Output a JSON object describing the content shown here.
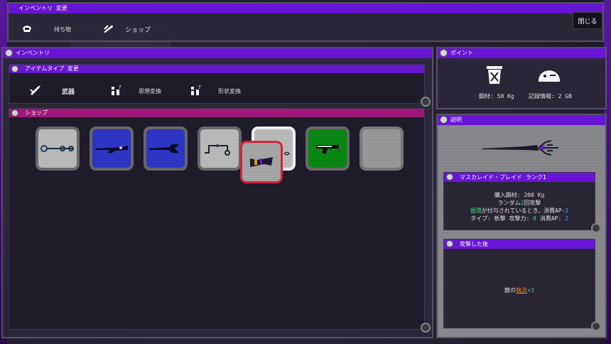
{
  "top_panel": {
    "title": "インベントリ 変更",
    "tabs": [
      {
        "label": "持ち物",
        "icon": "bag-icon"
      },
      {
        "label": "ショップ",
        "icon": "shop-icon"
      }
    ],
    "close_label": "閉じる"
  },
  "inventory": {
    "title": "インベントリ",
    "type_bar_title": "アイテムタイプ 変更",
    "types": [
      {
        "label": "武器",
        "icon": "weapon-icon"
      },
      {
        "label": "思想変換",
        "icon": "thought-icon"
      },
      {
        "label": "形状変換",
        "icon": "shape-icon"
      }
    ],
    "shop_title": "ショップ",
    "slots": [
      {
        "bg": "#bcbcbc",
        "icon": "chain-weapon-icon"
      },
      {
        "bg": "#2e36c8",
        "icon": "rifle-weapon-icon"
      },
      {
        "bg": "#2e36c8",
        "icon": "scissors-weapon-icon"
      },
      {
        "bg": "#bcbcbc",
        "icon": "hook-chain-weapon-icon"
      },
      {
        "bg": "#bcbcbc",
        "icon": "blade-weapon-icon",
        "selected": true
      },
      {
        "bg": "#0a8a14",
        "icon": "pistol-weapon-icon"
      },
      {
        "bg": "#9a9a9a",
        "icon": "empty-slot"
      }
    ],
    "held_item_icon": "held-item-icon"
  },
  "points": {
    "title": "ポイント",
    "materials_label": "鋼材: 50 Kg",
    "memory_label": "記録情報: 2 GB"
  },
  "description": {
    "title": "説明",
    "item_name": "マスカレイド・ブレイド ランク1",
    "lines": {
      "cost": "購入鋼材: 200 Kg",
      "attack_pre": "ランダム",
      "attack_num": "2",
      "attack_post": "回攻撃",
      "cond_word": "循環",
      "cond_mid": "が付与されているとき、消費AP-",
      "cond_num": "2",
      "type_pre": "タイプ: 斬撃  攻撃力: ",
      "power": "8",
      "ap_label": "  消費AP: ",
      "ap": "2"
    },
    "after_title": "攻撃した後",
    "after_pre": "敵の",
    "after_word": "執念",
    "after_post": "+3"
  },
  "colors": {
    "accent": "#6a16d8",
    "shop_bar": "#a01a7a",
    "selected_border": "#d8233e"
  }
}
